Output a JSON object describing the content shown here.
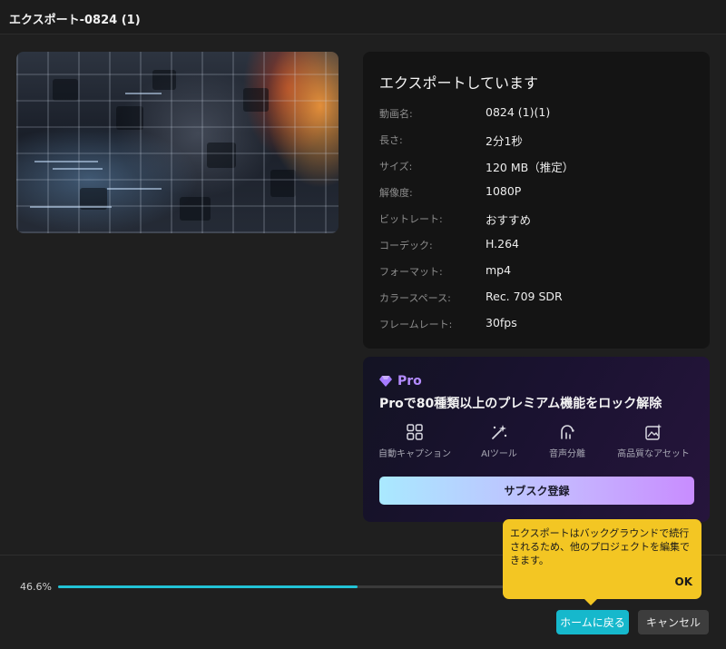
{
  "window": {
    "title": "エクスポート-0824 (1)"
  },
  "info": {
    "heading": "エクスポートしています",
    "rows": [
      {
        "key": "動画名:",
        "value": "0824 (1)(1)"
      },
      {
        "key": "長さ:",
        "value": "2分1秒"
      },
      {
        "key": "サイズ:",
        "value": "120 MB（推定）"
      },
      {
        "key": "解像度:",
        "value": "1080P"
      },
      {
        "key": "ビットレート:",
        "value": "おすすめ"
      },
      {
        "key": "コーデック:",
        "value": "H.264"
      },
      {
        "key": "フォーマット:",
        "value": "mp4"
      },
      {
        "key": "カラースペース:",
        "value": "Rec. 709 SDR"
      },
      {
        "key": "フレームレート:",
        "value": "30fps"
      }
    ]
  },
  "pro": {
    "badge": "Pro",
    "headline": "Proで80種類以上のプレミアム機能をロック解除",
    "features": [
      {
        "icon": "grid-squares-icon",
        "label": "自動キャプション"
      },
      {
        "icon": "magic-wand-icon",
        "label": "AIツール"
      },
      {
        "icon": "voice-separation-icon",
        "label": "音声分離"
      },
      {
        "icon": "premium-asset-icon",
        "label": "高品質なアセット"
      }
    ],
    "subscribe_label": "サブスク登録",
    "accent": "#b48cff"
  },
  "progress": {
    "percent_text": "46.6%",
    "fraction": 0.466,
    "color": "#22c3d6"
  },
  "tooltip": {
    "message": "エクスポートはバックグラウンドで続行されるため、他のプロジェクトを編集できます。",
    "ok_label": "OK",
    "color": "#f3c623"
  },
  "buttons": {
    "home_label": "ホームに戻る",
    "cancel_label": "キャンセル"
  }
}
